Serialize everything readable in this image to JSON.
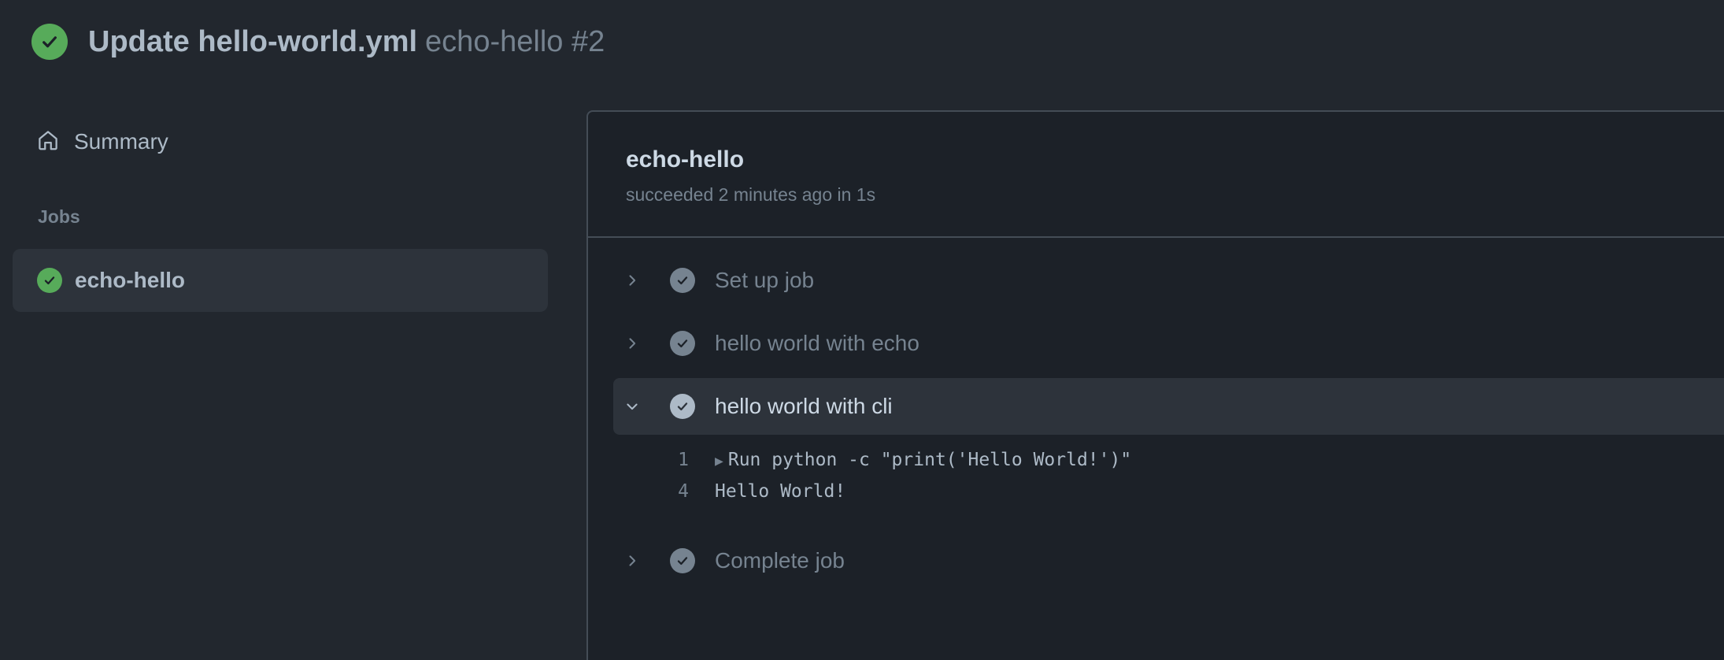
{
  "header": {
    "title": "Update hello-world.yml",
    "subtitle": "echo-hello #2",
    "status_icon": "check-circle-fill-icon",
    "status_color": "#57ab5a"
  },
  "sidebar": {
    "summary_label": "Summary",
    "summary_icon": "home-icon",
    "jobs_heading": "Jobs",
    "jobs": [
      {
        "label": "echo-hello",
        "status": "success",
        "selected": true
      }
    ]
  },
  "job": {
    "title": "echo-hello",
    "meta": "succeeded 2 minutes ago in 1s",
    "steps": [
      {
        "label": "Set up job",
        "expanded": false
      },
      {
        "label": "hello world with echo",
        "expanded": false
      },
      {
        "label": "hello world with cli",
        "expanded": true
      },
      {
        "label": "Complete job",
        "expanded": false
      }
    ],
    "log": [
      {
        "line": "1",
        "text": "Run python -c \"print('Hello World!')\"",
        "collapsible": true
      },
      {
        "line": "4",
        "text": "Hello World!",
        "collapsible": false
      }
    ]
  },
  "colors": {
    "background": "#22272e",
    "panel": "#1c2128",
    "success": "#57ab5a",
    "muted": "#768390"
  }
}
